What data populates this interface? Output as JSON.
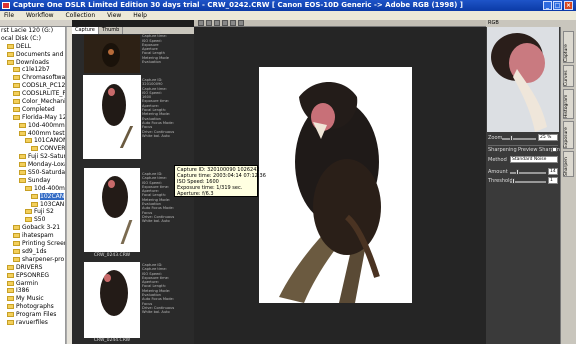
{
  "window": {
    "title": "Capture One DSLR Limited Edition 30 days trial  -  CRW_0242.CRW   [ Canon EOS-10D Generic -> Adobe RGB (1998) ]"
  },
  "menu": [
    "File",
    "Workflow",
    "Collection",
    "View",
    "Help"
  ],
  "tree": [
    {
      "label": "rst Lacie 120 (G:)",
      "indent": 0,
      "folder": false
    },
    {
      "label": "ocal Disk (C:)",
      "indent": 0,
      "folder": false
    },
    {
      "label": "DELL",
      "indent": 1,
      "folder": true
    },
    {
      "label": "Documents and Sett",
      "indent": 1,
      "folder": true
    },
    {
      "label": "Downloads",
      "indent": 1,
      "folder": true
    },
    {
      "label": "c1le12b7",
      "indent": 2,
      "folder": true
    },
    {
      "label": "Chromasoftware",
      "indent": 2,
      "folder": true
    },
    {
      "label": "CODSLR_PC12A5",
      "indent": 2,
      "folder": true
    },
    {
      "label": "CODSLRLITE_PC1",
      "indent": 2,
      "folder": true
    },
    {
      "label": "Color_Mechanic",
      "indent": 2,
      "folder": true
    },
    {
      "label": "Completed",
      "indent": 2,
      "folder": true
    },
    {
      "label": "Florida-May 12 to",
      "indent": 2,
      "folder": true
    },
    {
      "label": "10d-400mm-Se",
      "indent": 3,
      "folder": true
    },
    {
      "label": "400mm test Fl",
      "indent": 3,
      "folder": true
    },
    {
      "label": "101CANON",
      "indent": 4,
      "folder": true
    },
    {
      "label": "CONVER",
      "indent": 5,
      "folder": true
    },
    {
      "label": "Fuji S2-Saturd",
      "indent": 3,
      "folder": true
    },
    {
      "label": "Monday-Loxah",
      "indent": 3,
      "folder": true
    },
    {
      "label": "S50-Saturday",
      "indent": 3,
      "folder": true
    },
    {
      "label": "Sunday",
      "indent": 3,
      "folder": true
    },
    {
      "label": "10d-400mm",
      "indent": 4,
      "folder": true
    },
    {
      "label": "102CAN",
      "indent": 5,
      "folder": true,
      "selected": true
    },
    {
      "label": "103CAN",
      "indent": 5,
      "folder": true
    },
    {
      "label": "Fuji S2",
      "indent": 4,
      "folder": true
    },
    {
      "label": "S50",
      "indent": 4,
      "folder": true
    },
    {
      "label": "Goback 3-21",
      "indent": 2,
      "folder": true
    },
    {
      "label": "ihatespam",
      "indent": 2,
      "folder": true
    },
    {
      "label": "Printing Screen Sh",
      "indent": 2,
      "folder": true
    },
    {
      "label": "sd9_1ds",
      "indent": 2,
      "folder": true
    },
    {
      "label": "sharpener-pro",
      "indent": 2,
      "folder": true
    },
    {
      "label": "DRIVERS",
      "indent": 1,
      "folder": true
    },
    {
      "label": "EPSONREG",
      "indent": 1,
      "folder": true
    },
    {
      "label": "Garmin",
      "indent": 1,
      "folder": true
    },
    {
      "label": "I386",
      "indent": 1,
      "folder": true
    },
    {
      "label": "My Music",
      "indent": 1,
      "folder": true
    },
    {
      "label": "Photographs",
      "indent": 1,
      "folder": true
    },
    {
      "label": "Program Files",
      "indent": 1,
      "folder": true
    },
    {
      "label": "ravuerfiles",
      "indent": 1,
      "folder": true
    }
  ],
  "thumb_tabs": [
    "Capture",
    "Thumb"
  ],
  "thumbnails": [
    {
      "caption": "",
      "meta": "Capture ID:\nCapture time:\nISO Speed:\nExposure\nAperture\nFocal Length\nMetering Mode\nEvaluation"
    },
    {
      "caption": "CRW_0242.CRW",
      "meta": "Capture ID:\n320100090\nCapture time:\nISO Speed:\n1600\nExposure time:\nAperture:\nFocal Length:\nMetering Mode:\nEvaluation\nAuto Focus Mode:\nFocus\nDrive: Continuous\nWhite bal. Auto"
    },
    {
      "caption": "CRW_0243.CRW",
      "meta": "Capture ID:\nCapture time:\nISO Speed:\nExposure time:\nAperture:\nFocal Length:\nMetering Mode:\nEvaluation\nAuto Focus Mode:\nFocus\nDrive: Continuous\nWhite bal. Auto"
    },
    {
      "caption": "CRW_0244.CRW",
      "meta": "Capture ID:\nCapture time:\nISO Speed:\nExposure time:\nAperture:\nFocal Length:\nMetering Mode:\nEvaluation\nAuto Focus Mode:\nFocus\nDrive: Continuous\nWhite bal. Auto"
    }
  ],
  "tooltip": {
    "lines": [
      "Capture ID: 320100090 1026242",
      "Capture time: 2003:04:14 07:12:36",
      "ISO Speed: 1600",
      "Exposure time: 1/319 sec.",
      "Aperture: f/6.3"
    ]
  },
  "right_panel": {
    "zoom_label": "Zoom",
    "zoom_value": "25 %",
    "sharpening_label": "Sharpening",
    "preview_sharpen_label": "Preview Sharpen",
    "method_label": "Method",
    "method_value": "Standard Noise",
    "amount_label": "Amount",
    "amount_value": "14",
    "threshold_label": "Threshold",
    "threshold_value": "1",
    "vtabs": [
      "Capture",
      "Curves",
      "Histogram",
      "Exposure",
      "Sharpen"
    ],
    "top_label": "RGB"
  },
  "colors": {
    "titlebar": "#0b3aa6",
    "selection": "#316ac5",
    "viewer_bg": "#252525"
  }
}
